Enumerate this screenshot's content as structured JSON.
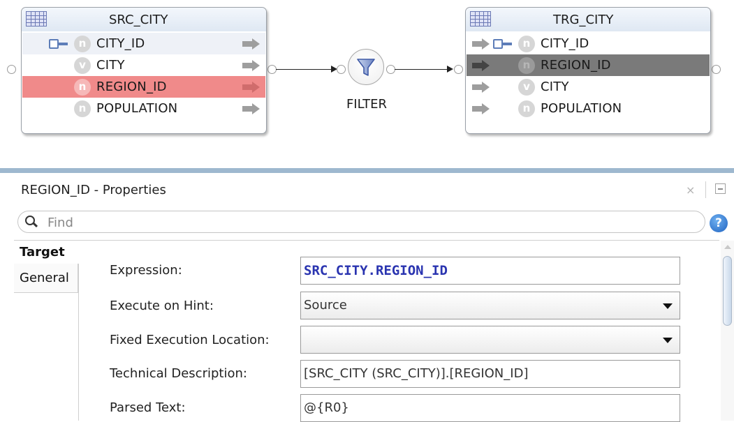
{
  "mapping": {
    "source": {
      "name": "SRC_CITY",
      "columns": [
        {
          "name": "CITY_ID",
          "type_badge": "n",
          "key": true
        },
        {
          "name": "CITY",
          "type_badge": "v",
          "key": false
        },
        {
          "name": "REGION_ID",
          "type_badge": "n",
          "key": false,
          "highlight": "red"
        },
        {
          "name": "POPULATION",
          "type_badge": "n",
          "key": false
        }
      ]
    },
    "filter": {
      "label": "FILTER",
      "icon": "funnel-icon"
    },
    "target": {
      "name": "TRG_CITY",
      "columns": [
        {
          "name": "CITY_ID",
          "type_badge": "n",
          "key": true
        },
        {
          "name": "REGION_ID",
          "type_badge": "n",
          "key": false,
          "highlight": "selected"
        },
        {
          "name": "CITY",
          "type_badge": "v",
          "key": false
        },
        {
          "name": "POPULATION",
          "type_badge": "n",
          "key": false
        }
      ]
    }
  },
  "properties": {
    "title": "REGION_ID - Properties",
    "close_glyph": "×",
    "search": {
      "placeholder": "Find"
    },
    "help_glyph": "?",
    "tabs": [
      {
        "label": "Target",
        "active": true
      },
      {
        "label": "General",
        "active": false
      }
    ],
    "fields": [
      {
        "label": "Expression:",
        "value": "SRC_CITY.REGION_ID",
        "kind": "text"
      },
      {
        "label": "Execute on Hint:",
        "value": "Source",
        "kind": "select"
      },
      {
        "label": "Fixed Execution Location:",
        "value": "",
        "kind": "select"
      },
      {
        "label": "Technical Description:",
        "value": "[SRC_CITY (SRC_CITY)].[REGION_ID]",
        "kind": "text"
      },
      {
        "label": "Parsed Text:",
        "value": "@{R0}",
        "kind": "text"
      }
    ]
  },
  "colors": {
    "highlight_red": "#f08a8a",
    "highlight_selected": "#7a7a7a",
    "expression_text": "#2a34b0",
    "panel_topbar": "#9eb8cf"
  }
}
